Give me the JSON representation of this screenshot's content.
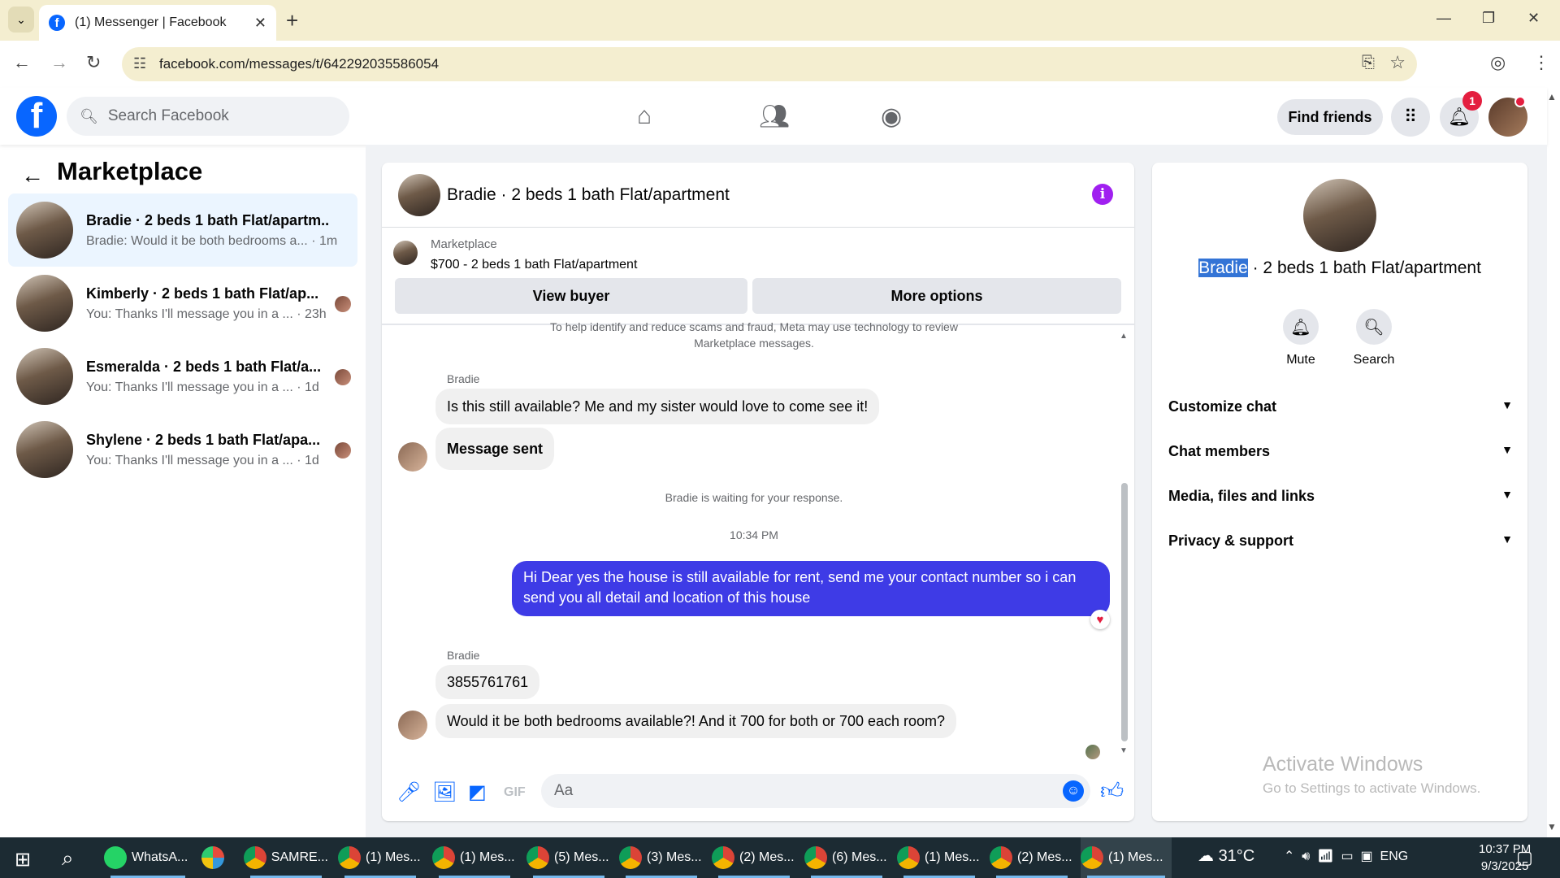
{
  "browser": {
    "tab_title": "(1) Messenger | Facebook",
    "url": "facebook.com/messages/t/642292035586054",
    "icons": [
      "chevron-down-icon",
      "facebook-icon",
      "close-icon",
      "plus-icon",
      "minimize-icon",
      "restore-icon",
      "close-icon",
      "back-icon",
      "forward-icon",
      "reload-icon",
      "tune-icon",
      "install-icon",
      "star-icon",
      "profile-icon",
      "menu-icon"
    ]
  },
  "fb": {
    "search_placeholder": "Search Facebook",
    "find_friends": "Find friends",
    "notif_count": "1"
  },
  "sidebar": {
    "title": "Marketplace",
    "conversations": [
      {
        "title": "Bradie · 2 beds 1 bath Flat/apartm...",
        "preview": "Bradie: Would it be both bedrooms a... · 1m"
      },
      {
        "title": "Kimberly · 2 beds 1 bath Flat/ap...",
        "preview": "You: Thanks I'll message you in a ... · 23h"
      },
      {
        "title": "Esmeralda · 2 beds 1 bath Flat/a...",
        "preview": "You: Thanks I'll message you in a ... · 1d"
      },
      {
        "title": "Shylene · 2 beds 1 bath Flat/apa...",
        "preview": "You: Thanks I'll message you in a ... · 1d"
      }
    ]
  },
  "chat": {
    "title": "Bradie · 2 beds 1 bath Flat/apartment",
    "listing_source": "Marketplace",
    "listing_detail": "$700 - 2 beds 1 bath Flat/apartment",
    "view_buyer": "View buyer",
    "more_options": "More options",
    "notice_line1": "To help identify and reduce scams and fraud, Meta may use technology to review",
    "notice_line2": "Marketplace messages.",
    "sender_1": "Bradie",
    "msg_1": "Is this still available? Me and my sister would love to come see it!",
    "msg_2": "Message sent",
    "waiting": "Bradie is waiting for your response.",
    "time": "10:34 PM",
    "my_msg_line1": "Hi Dear yes the house is still available for rent, send me your contact number so i can",
    "my_msg_line2": "send you all detail and location of this house",
    "sender_2": "Bradie",
    "msg_3": "3855761761",
    "msg_4": "Would it be both bedrooms available?! And it 700 for both or 700 each room?",
    "input_placeholder": "Aa"
  },
  "info": {
    "name_highlight": "Bradie",
    "name_rest": " · 2 beds 1 bath Flat/apartment",
    "mute": "Mute",
    "search": "Search",
    "rows": [
      "Customize chat",
      "Chat members",
      "Media, files and links",
      "Privacy & support"
    ],
    "activate_title": "Activate Windows",
    "activate_sub": "Go to Settings to activate Windows."
  },
  "taskbar": {
    "items": [
      "WhatsA...",
      "SAMRE...",
      "(1) Mes...",
      "(1) Mes...",
      "(5) Mes...",
      "(3) Mes...",
      "(2) Mes...",
      "(6) Mes...",
      "(1) Mes...",
      "(2) Mes...",
      "(1) Mes..."
    ],
    "weather": "31°C",
    "lang": "ENG",
    "time": "10:37 PM",
    "date": "9/3/2025"
  },
  "colors": {
    "accent": "#0866ff",
    "my_bubble": "#3e3be6",
    "info_icon": "#a020f0",
    "badge": "#e41e3f"
  }
}
